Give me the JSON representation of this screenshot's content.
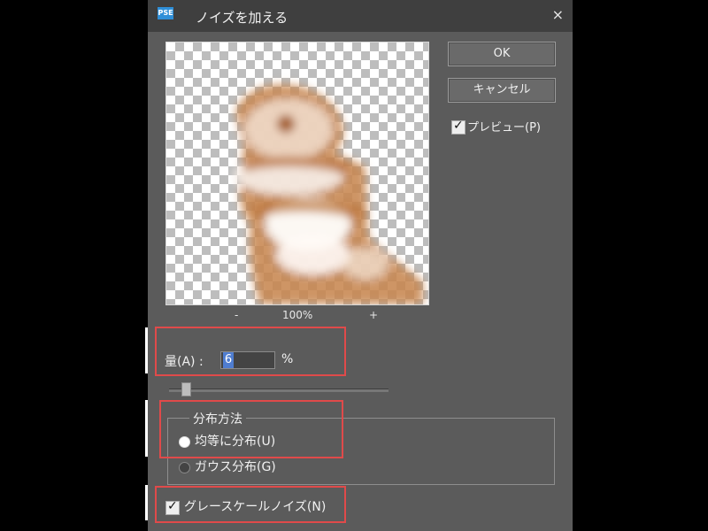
{
  "window": {
    "title": "ノイズを加える",
    "icon_name": "app-icon",
    "icon_text": "PSE"
  },
  "buttons": {
    "ok_label": "OK",
    "cancel_label": "キャンセル"
  },
  "preview": {
    "label": "プレビュー(P)",
    "checked": true
  },
  "zoom": {
    "minus": "-",
    "value": "100%",
    "plus": "+"
  },
  "amount": {
    "label": "量(A) :",
    "value": "6",
    "unit": "%"
  },
  "distribution": {
    "title": "分布方法",
    "options": [
      {
        "label": "均等に分布(U)",
        "selected": true
      },
      {
        "label": "ガウス分布(G)",
        "selected": false
      }
    ]
  },
  "grayscale": {
    "label": "グレースケールノイズ(N)",
    "checked": true
  },
  "colors": {
    "highlight": "#e04a4a",
    "dialog_bg": "#5b5b5b",
    "selection": "#4f7dd0"
  }
}
